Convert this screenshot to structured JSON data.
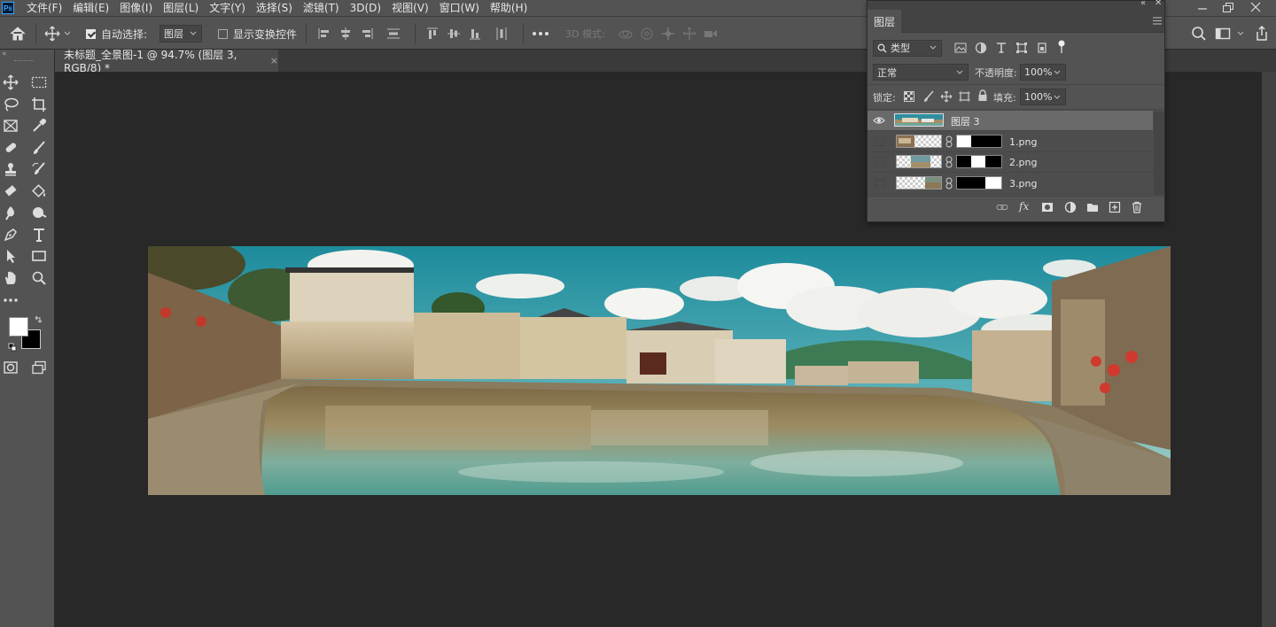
{
  "app": {
    "logo_text": "Ps"
  },
  "menu": {
    "items": [
      "文件(F)",
      "编辑(E)",
      "图像(I)",
      "图层(L)",
      "文字(Y)",
      "选择(S)",
      "滤镜(T)",
      "3D(D)",
      "视图(V)",
      "窗口(W)",
      "帮助(H)"
    ]
  },
  "options": {
    "auto_select_label": "自动选择:",
    "auto_select_target": "图层",
    "show_transform_label": "显示变换控件",
    "mode_3d_label": "3D 模式:"
  },
  "document": {
    "tab_title": "未标题_全景图-1 @ 94.7% (图层 3, RGB/8) *",
    "close_glyph": "×"
  },
  "layers_panel": {
    "title": "图层",
    "filter_kind": "类型",
    "blend_mode": "正常",
    "opacity_label": "不透明度:",
    "opacity_value": "100%",
    "lock_label": "锁定:",
    "fill_label": "填充:",
    "fill_value": "100%",
    "layers": [
      {
        "name": "图层 3",
        "visible": true,
        "selected": true,
        "has_mask": false
      },
      {
        "name": "1.png",
        "visible": false,
        "selected": false,
        "has_mask": true
      },
      {
        "name": "2.png",
        "visible": false,
        "selected": false,
        "has_mask": true
      },
      {
        "name": "3.png",
        "visible": false,
        "selected": false,
        "has_mask": true
      }
    ],
    "fx_label": "fx"
  },
  "colors": {
    "foreground": "#ffffff",
    "background": "#000000",
    "accent": "#31a8ff"
  }
}
